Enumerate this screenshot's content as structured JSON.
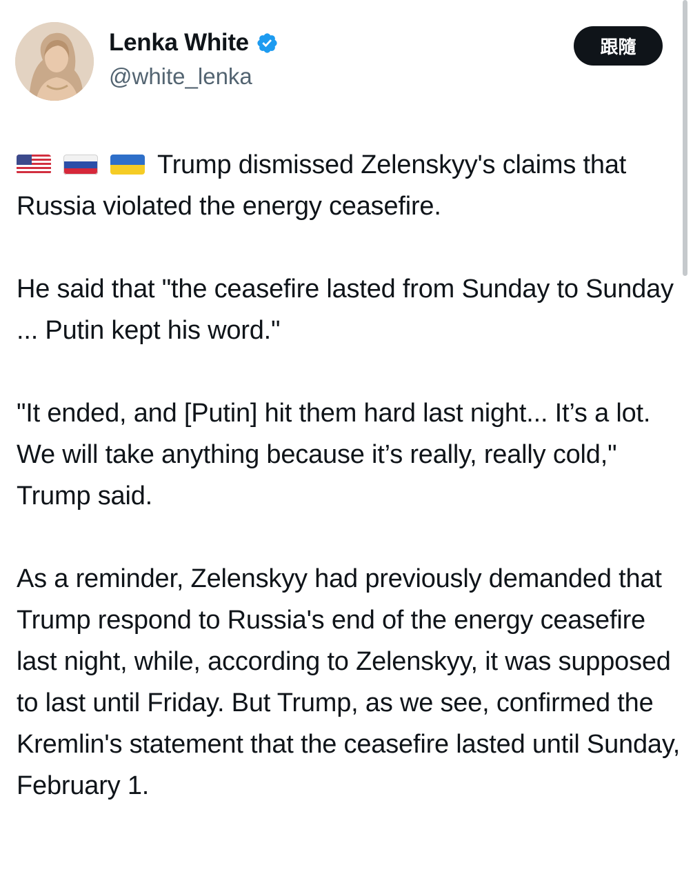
{
  "author": {
    "display_name": "Lenka White",
    "handle": "@white_lenka",
    "verified": true,
    "avatar_icon": "profile-photo",
    "verified_icon": "verified-badge-icon"
  },
  "follow_button": {
    "label": "跟隨"
  },
  "tweet": {
    "flags": [
      "flag-us-icon",
      "flag-ru-icon",
      "flag-ua-icon"
    ],
    "paragraphs": [
      "Trump dismissed Zelenskyy's claims that Russia violated the energy ceasefire.",
      "He said that \"the ceasefire lasted from Sunday to Sunday ... Putin kept his word.\"",
      "\"It ended, and [Putin] hit them hard last night... It’s a lot. We will take anything because it’s really, really cold,\" Trump said.",
      "As a reminder, Zelenskyy had previously demanded that Trump respond to Russia's end of the energy ceasefire last night, while, according to Zelenskyy, it was supposed to last until Friday. But Trump, as we see, confirmed the Kremlin's statement that the ceasefire lasted until Sunday, February 1."
    ]
  },
  "colors": {
    "text": "#0f1419",
    "secondary": "#536471",
    "verified_blue": "#1d9bf0",
    "button_bg": "#0f1419"
  }
}
